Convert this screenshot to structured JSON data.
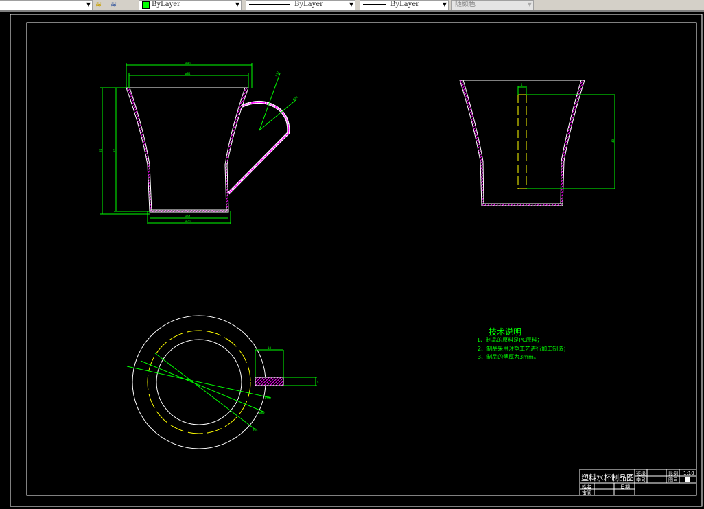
{
  "toolbar": {
    "color_combo": "ByLayer",
    "linetype_combo": "ByLayer",
    "lineweight_combo": "ByLayer",
    "plotstyle_combo": "随颜色",
    "color_swatch": "#00ff00"
  },
  "drawing": {
    "front_view_dims": {
      "top_outer": "ø90",
      "top_inner": "ø84",
      "height_outer": "84",
      "height_inner": "87",
      "bottom_inner": "ø64",
      "bottom_outer": "ø70",
      "radius_1": "R32",
      "radius_2": "R30"
    },
    "side_view_dims": {
      "width": "4",
      "height": "48"
    },
    "top_view_dims": {
      "handle_width": "18",
      "handle_thick": "4",
      "d1": "ø90",
      "d2": "ø84",
      "d3": "ø64"
    },
    "colors": {
      "outline": "#ffffff",
      "dimension": "#00ff00",
      "hatch": "#ff00ff",
      "hidden": "#ffff00"
    }
  },
  "notes": {
    "title": "技术说明",
    "items": [
      "1、制品的原料是PC原料；",
      "2、制品采用注塑工艺进行加工制造；",
      "3、制品的壁厚为3mm。"
    ]
  },
  "title_block": {
    "title": "塑料水杯制品图",
    "class_label": "班级",
    "student_no_label": "学号",
    "scale_label": "比例",
    "scale_value": "1:10",
    "drawing_no_label": "图号",
    "name_label": "姓名",
    "date_label": "日期",
    "review_label": "审阅"
  }
}
